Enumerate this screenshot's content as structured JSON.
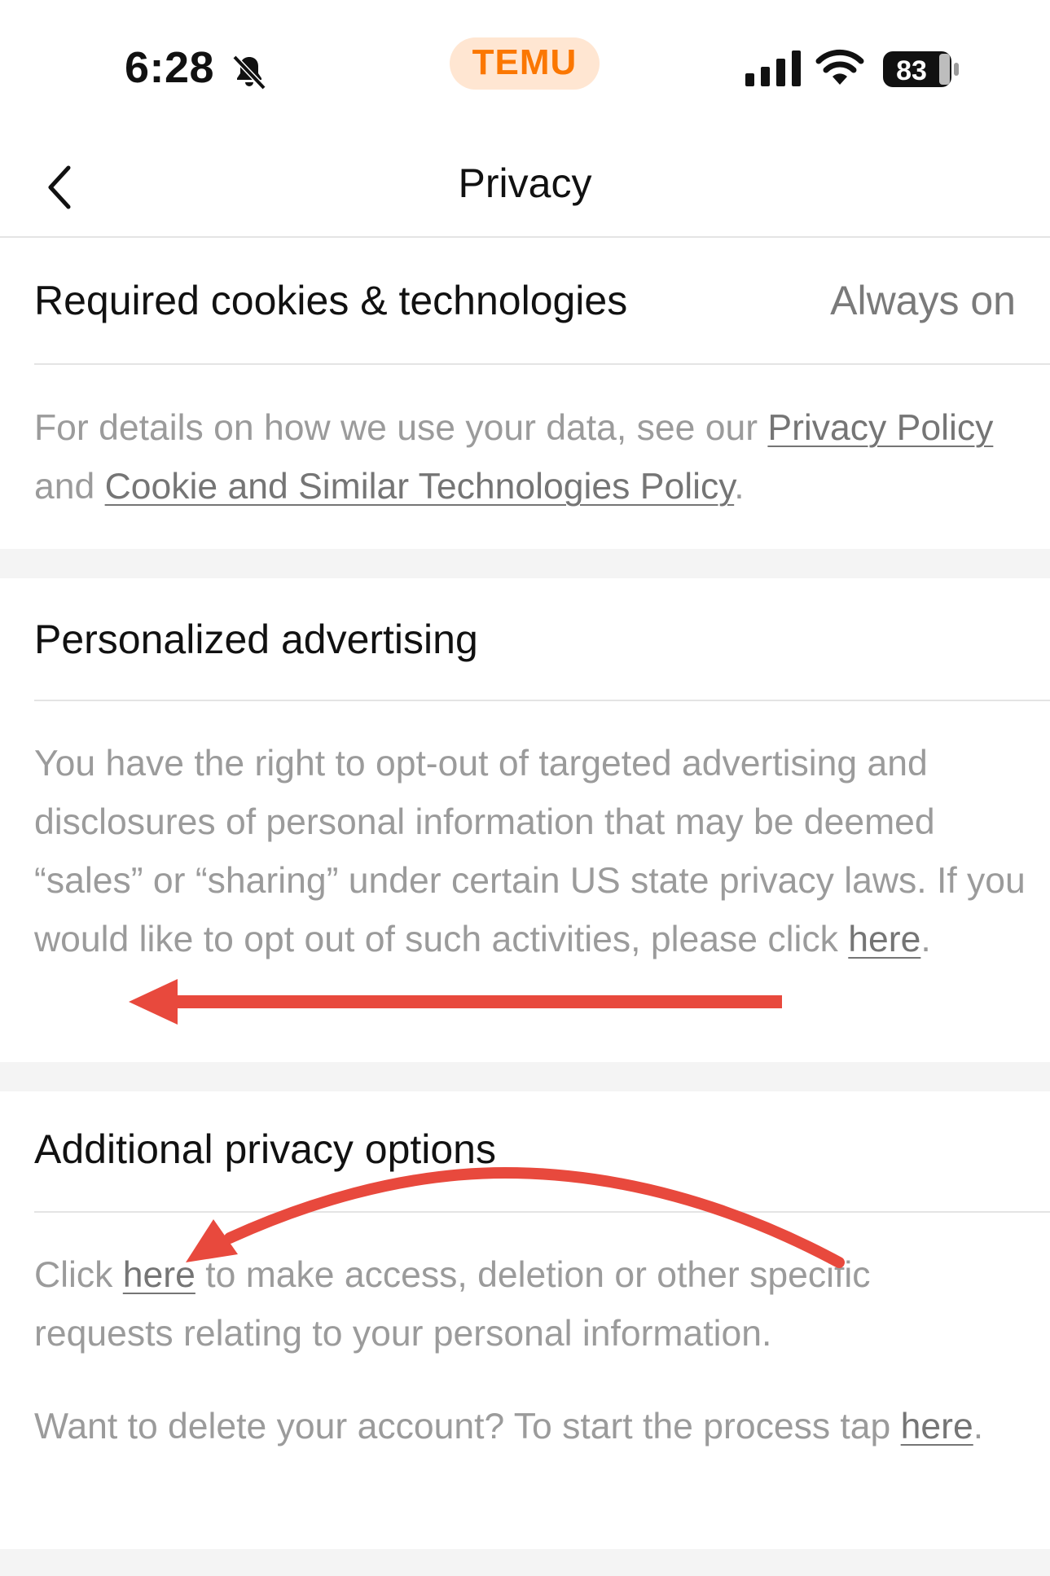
{
  "status_bar": {
    "time": "6:28",
    "carrier": "TEMU",
    "battery": "83",
    "icons": [
      "bell-muted-icon",
      "signal-icon",
      "wifi-icon",
      "battery-icon"
    ]
  },
  "nav": {
    "title": "Privacy",
    "back_icon": "chevron-left-icon"
  },
  "required": {
    "title": "Required cookies & technologies",
    "status": "Always on",
    "text_before": "For details on how we use your data, see our ",
    "link_privacy": "Privacy Policy",
    "text_and": " and ",
    "link_cookie": "Cookie and Similar Technologies Policy",
    "text_end": "."
  },
  "ads": {
    "title": "Personalized advertising",
    "text": "You have the right to opt-out of targeted advertising and disclosures of personal information that may be deemed “sales” or “sharing” under certain US state privacy laws. If you would like to opt out of such activities, please click ",
    "link": "here",
    "text_end": "."
  },
  "additional": {
    "title": "Additional privacy options",
    "p1_before": "Click ",
    "p1_link": "here",
    "p1_after": " to make access, deletion or other specific requests relating to your personal information.",
    "p2_before": "Want to delete your account? To start the process tap ",
    "p2_link": "here",
    "p2_after": "."
  },
  "colors": {
    "brand": "#fb7701",
    "arrow": "#e8493d",
    "muted_text": "#9b9b9b"
  }
}
